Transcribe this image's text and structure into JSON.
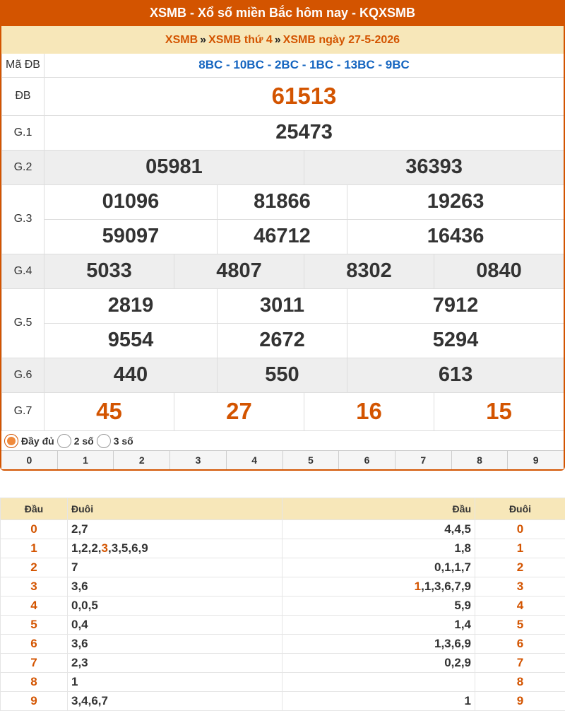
{
  "header": {
    "title": "XSMB - Xổ số miền Bắc hôm nay - KQXSMB",
    "crumb1": "XSMB",
    "crumb2": "XSMB thứ 4",
    "crumb3": "XSMB ngày 27-5-2026",
    "sep": "»"
  },
  "results": {
    "madb_label": "Mã ĐB",
    "madb_value": "8BC - 10BC - 2BC - 1BC - 13BC - 9BC",
    "db_label": "ĐB",
    "db": "61513",
    "g1_label": "G.1",
    "g1": "25473",
    "g2_label": "G.2",
    "g2": [
      "05981",
      "36393"
    ],
    "g3_label": "G.3",
    "g3": [
      "01096",
      "81866",
      "19263",
      "59097",
      "46712",
      "16436"
    ],
    "g4_label": "G.4",
    "g4": [
      "5033",
      "4807",
      "8302",
      "0840"
    ],
    "g5_label": "G.5",
    "g5": [
      "2819",
      "3011",
      "7912",
      "9554",
      "2672",
      "5294"
    ],
    "g6_label": "G.6",
    "g6": [
      "440",
      "550",
      "613"
    ],
    "g7_label": "G.7",
    "g7": [
      "45",
      "27",
      "16",
      "15"
    ]
  },
  "options": {
    "full": "Đầy đủ",
    "two": "2 số",
    "three": "3 số",
    "digits": [
      "0",
      "1",
      "2",
      "3",
      "4",
      "5",
      "6",
      "7",
      "8",
      "9"
    ]
  },
  "colors": {
    "accent": "#d35400",
    "header_bg": "#f7e7b9",
    "madb": "#1565c0"
  },
  "loto": {
    "h_dau": "Đầu",
    "h_duoi": "Đuôi",
    "h_dau2": "Đầu",
    "h_duoi2": "Đuôi",
    "rows": [
      {
        "d": "0",
        "tail_pre": "2,7",
        "tail_hi": "",
        "tail_post": "",
        "head_hi": "",
        "head_post": "4,4,5",
        "d2": "0"
      },
      {
        "d": "1",
        "tail_pre": "1,2,2,",
        "tail_hi": "3",
        "tail_post": ",3,5,6,9",
        "head_hi": "",
        "head_post": "1,8",
        "d2": "1"
      },
      {
        "d": "2",
        "tail_pre": "7",
        "tail_hi": "",
        "tail_post": "",
        "head_hi": "",
        "head_post": "0,1,1,7",
        "d2": "2"
      },
      {
        "d": "3",
        "tail_pre": "3,6",
        "tail_hi": "",
        "tail_post": "",
        "head_hi": "1",
        "head_post": ",1,3,6,7,9",
        "d2": "3"
      },
      {
        "d": "4",
        "tail_pre": "0,0,5",
        "tail_hi": "",
        "tail_post": "",
        "head_hi": "",
        "head_post": "5,9",
        "d2": "4"
      },
      {
        "d": "5",
        "tail_pre": "0,4",
        "tail_hi": "",
        "tail_post": "",
        "head_hi": "",
        "head_post": "1,4",
        "d2": "5"
      },
      {
        "d": "6",
        "tail_pre": "3,6",
        "tail_hi": "",
        "tail_post": "",
        "head_hi": "",
        "head_post": "1,3,6,9",
        "d2": "6"
      },
      {
        "d": "7",
        "tail_pre": "2,3",
        "tail_hi": "",
        "tail_post": "",
        "head_hi": "",
        "head_post": "0,2,9",
        "d2": "7"
      },
      {
        "d": "8",
        "tail_pre": "1",
        "tail_hi": "",
        "tail_post": "",
        "head_hi": "",
        "head_post": "",
        "d2": "8"
      },
      {
        "d": "9",
        "tail_pre": "3,4,6,7",
        "tail_hi": "",
        "tail_post": "",
        "head_hi": "",
        "head_post": "1",
        "d2": "9"
      }
    ]
  }
}
